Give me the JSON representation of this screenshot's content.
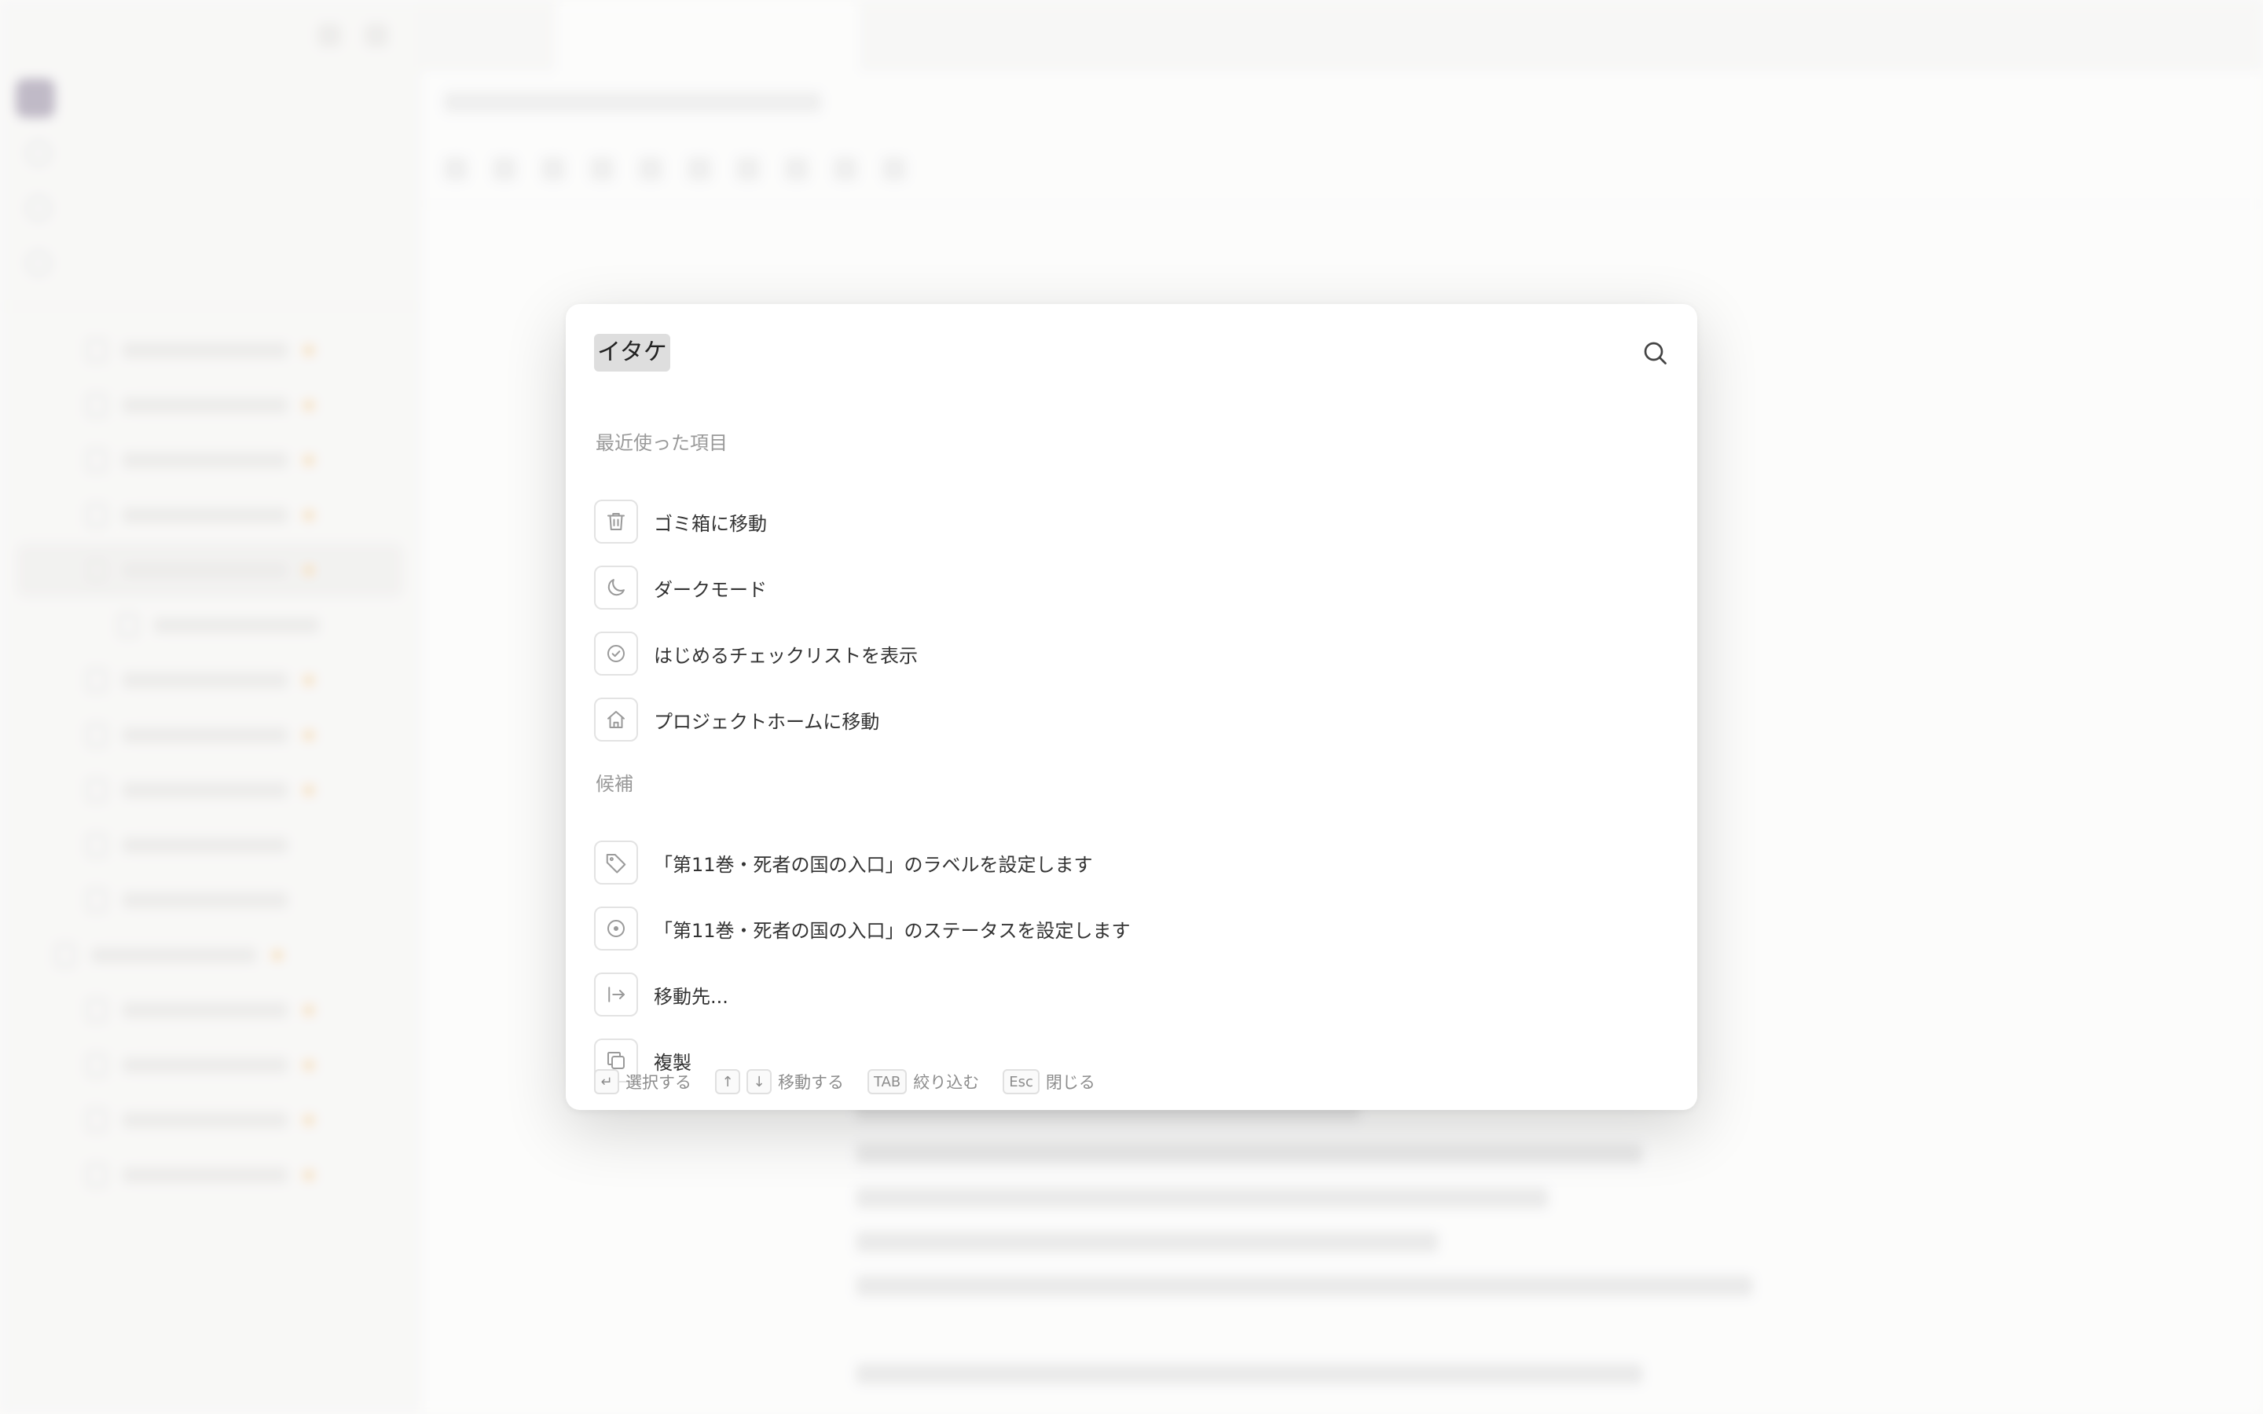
{
  "search": {
    "query": "イタケ"
  },
  "recent": {
    "title": "最近使った項目",
    "items": [
      {
        "label": "ゴミ箱に移動",
        "icon": "trash-icon"
      },
      {
        "label": "ダークモード",
        "icon": "moon-icon"
      },
      {
        "label": "はじめるチェックリストを表示",
        "icon": "check-circle-icon"
      },
      {
        "label": "プロジェクトホームに移動",
        "icon": "home-icon"
      }
    ]
  },
  "suggestions": {
    "title": "候補",
    "items": [
      {
        "label": "「第11巻・死者の国の入口」のラベルを設定します",
        "icon": "tag-icon"
      },
      {
        "label": "「第11巻・死者の国の入口」のステータスを設定します",
        "icon": "status-circle-icon"
      },
      {
        "label": "移動先...",
        "icon": "move-to-icon"
      },
      {
        "label": "複製",
        "icon": "duplicate-icon"
      }
    ]
  },
  "footer": {
    "select_key": "↵",
    "select_label": "選択する",
    "up_key": "↑",
    "down_key": "↓",
    "move_label": "移動する",
    "tab_key": "TAB",
    "filter_label": "絞り込む",
    "esc_key": "Esc",
    "close_label": "閉じる"
  }
}
